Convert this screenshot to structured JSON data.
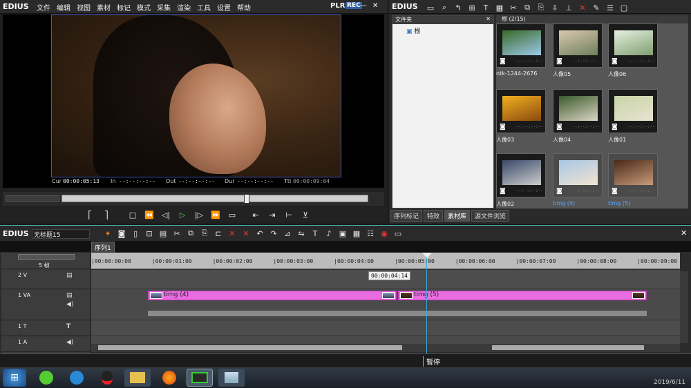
{
  "player": {
    "logo": "EDIUS",
    "menu": [
      "文件",
      "编辑",
      "视图",
      "素材",
      "标记",
      "模式",
      "采集",
      "渲染",
      "工具",
      "设置",
      "帮助"
    ],
    "plr": "PLR",
    "rec": "REC",
    "timecodes": {
      "cur_label": "Cur",
      "cur": "00:00:05:13",
      "in_label": "In",
      "in": "--:--:--:--",
      "out_label": "Out",
      "out": "--:--:--:--",
      "dur_label": "Dur",
      "dur": "--:--:--:--",
      "ttl_label": "Ttl",
      "ttl": "00:00:09:04"
    }
  },
  "bin": {
    "logo": "EDIUS",
    "folder_header": "文件夹",
    "root": "根",
    "clips_header": "根 (2/15)",
    "clips": [
      {
        "label": "ntk-1244-2676",
        "colors": [
          "#3a6a2a",
          "#9cc8e8"
        ],
        "selected": false
      },
      {
        "label": "人像05",
        "colors": [
          "#d9c9b0",
          "#6e7f5a"
        ],
        "selected": false
      },
      {
        "label": "人像06",
        "colors": [
          "#e6efe0",
          "#7fa070"
        ],
        "selected": false
      },
      {
        "label": "人像03",
        "colors": [
          "#f2b020",
          "#8a4a10"
        ],
        "selected": false
      },
      {
        "label": "人像04",
        "colors": [
          "#3a5a2a",
          "#dcd6c6"
        ],
        "selected": false
      },
      {
        "label": "人像01",
        "colors": [
          "#c7d4a6",
          "#e9e3d2"
        ],
        "selected": false
      },
      {
        "label": "人像02",
        "colors": [
          "#3a4a6a",
          "#ccc"
        ],
        "selected": false
      },
      {
        "label": "timg (4)",
        "colors": [
          "#a9c6e6",
          "#f0e4d0"
        ],
        "selected": true
      },
      {
        "label": "timg (5)",
        "colors": [
          "#4a2a1a",
          "#c89a7a"
        ],
        "selected": true
      }
    ],
    "clip_time": "--:--:--:--",
    "tabs": [
      "序列标记",
      "特效",
      "素材库",
      "源文件浏览"
    ],
    "active_tab": 2
  },
  "timeline": {
    "logo": "EDIUS",
    "project": "无标题15",
    "sequence_tab": "序列1",
    "frame_label": "5 帧",
    "ruler": [
      "00:00:00:00",
      "00:00:01:00",
      "00:00:02:00",
      "00:00:03:00",
      "00:00:04:00",
      "00:00:05:00",
      "00:00:06:00",
      "00:00:07:00",
      "00:00:08:00",
      "00:00:09:00"
    ],
    "tracks": [
      {
        "name": "2 V"
      },
      {
        "name": "1 VA"
      },
      {
        "name": "1 T"
      },
      {
        "name": "1 A"
      }
    ],
    "clips": [
      {
        "label": "timg (4)"
      },
      {
        "label": "timg (5)"
      }
    ],
    "tooltip": "00:00:04:14",
    "status": "暂停"
  },
  "taskbar": {
    "clock": "2019/6/11"
  }
}
